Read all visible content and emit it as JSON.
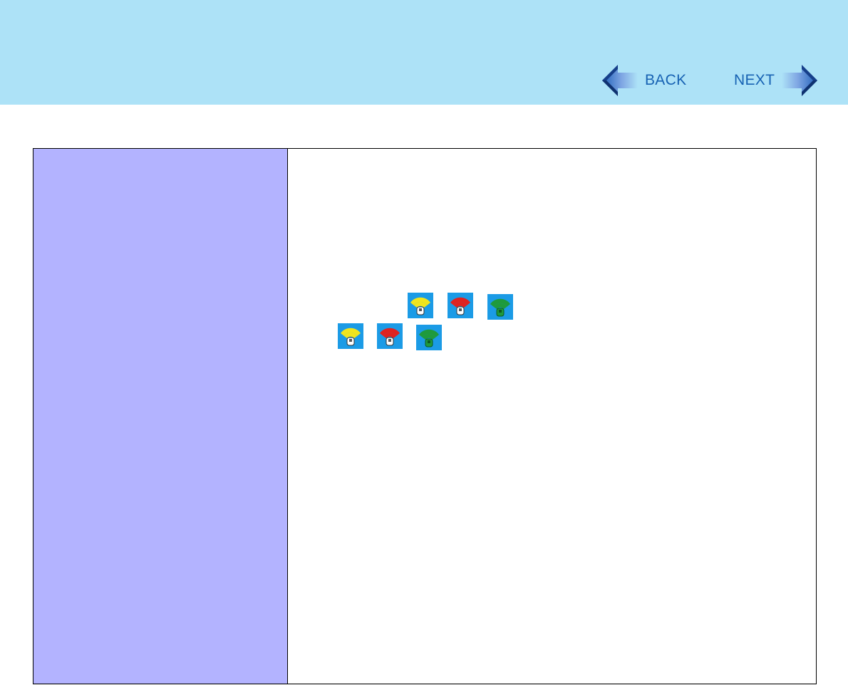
{
  "nav": {
    "back_label": "BACK",
    "next_label": "NEXT"
  },
  "colors": {
    "header_bg": "#ade2f7",
    "nav_text": "#1762b3",
    "left_column_bg": "#b3b3ff",
    "icon_bg": "#1b9be6",
    "signal_yellow": "#f2e51c",
    "signal_red": "#e0221f",
    "signal_green": "#1f9a3c"
  },
  "icons": {
    "row1": [
      "wireless-signal-yellow-icon",
      "wireless-signal-red-icon",
      "wireless-signal-green-icon"
    ],
    "row2": [
      "wireless-signal-yellow-icon",
      "wireless-signal-red-icon",
      "wireless-signal-green-icon"
    ]
  }
}
